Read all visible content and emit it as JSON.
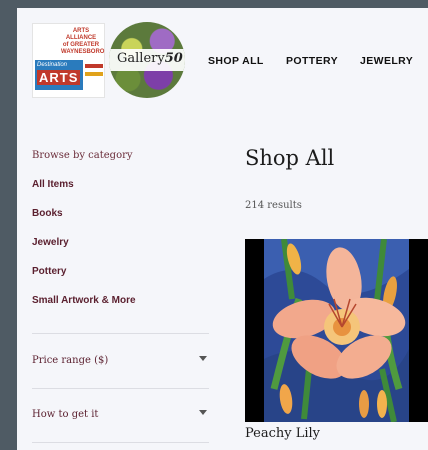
{
  "header": {
    "logos": {
      "arts_alliance_lines": [
        "ARTS",
        "ALLIANCE",
        "of GREATER",
        "WAYNESBORO"
      ],
      "destination_text": "Destination",
      "arts_text": "ARTS",
      "gallery_text_prefix": "Gallery",
      "gallery_text_number": "50"
    },
    "nav": [
      {
        "label": "SHOP ALL"
      },
      {
        "label": "POTTERY"
      },
      {
        "label": "JEWELRY"
      }
    ]
  },
  "sidebar": {
    "browse_label": "Browse by category",
    "categories": [
      {
        "label": "All Items"
      },
      {
        "label": "Books"
      },
      {
        "label": "Jewelry"
      },
      {
        "label": "Pottery"
      },
      {
        "label": "Small Artwork & More"
      }
    ],
    "filters": [
      {
        "label": "Price range ($)"
      },
      {
        "label": "How to get it"
      }
    ]
  },
  "main": {
    "title": "Shop All",
    "results": "214 results",
    "products": [
      {
        "name": "Peachy Lily"
      }
    ]
  },
  "colors": {
    "frame": "#4f5b64",
    "page_bg": "#f5f6fa",
    "category_text": "#5a1f2e",
    "arts_red": "#c0392b",
    "arts_blue": "#2a7bbd"
  }
}
